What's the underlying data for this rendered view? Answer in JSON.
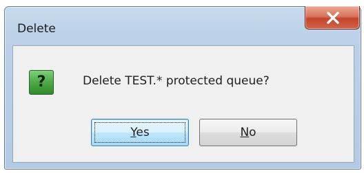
{
  "window": {
    "title": "Delete"
  },
  "title_bar": {
    "close_icon": "close-x-icon"
  },
  "dialog": {
    "icon": "question-icon",
    "icon_glyph": "?",
    "message": "Delete TEST.* protected queue?"
  },
  "buttons": {
    "yes": {
      "accel": "Y",
      "rest": "es"
    },
    "no": {
      "accel": "N",
      "rest": "o"
    }
  },
  "colors": {
    "icon_green": "#4ea847",
    "close_red": "#c4442b"
  }
}
